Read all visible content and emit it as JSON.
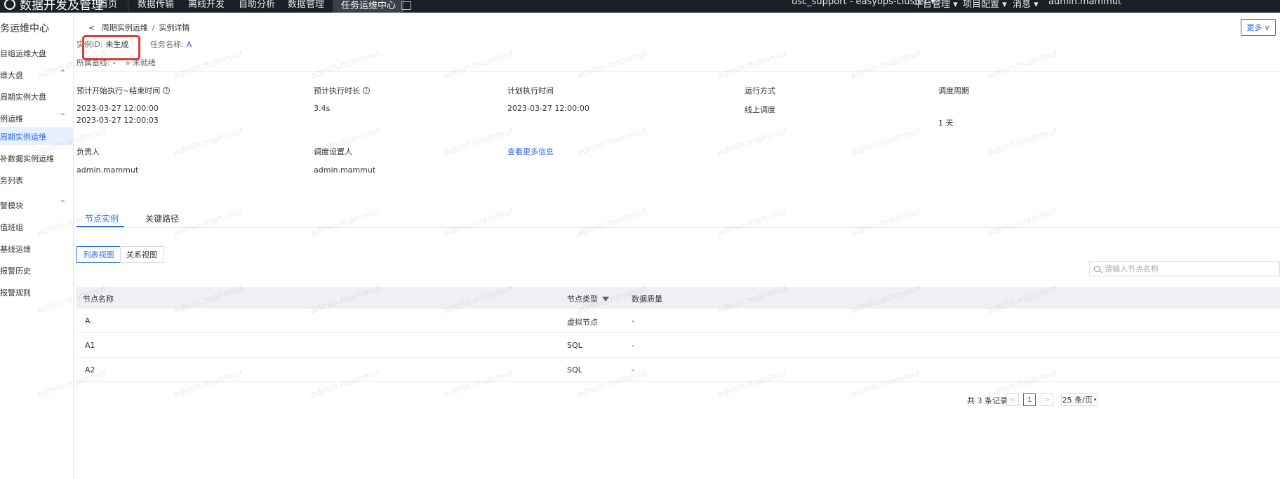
{
  "topbar": {
    "logo": "数据开发及管理",
    "tabs": [
      "首页",
      "数据传输",
      "离线开发",
      "自助分析",
      "数据管理",
      "任务运维中心"
    ],
    "active_tab": "任务运维中心",
    "cluster": "usc_support - easyops-cluster",
    "platform": "平台管理",
    "project": "项目配置",
    "messages": "消息",
    "user": "admin.mammut"
  },
  "sidebar": {
    "title": "务运维中心",
    "items": [
      {
        "label": "目组运维大盘",
        "chevron": ""
      },
      {
        "label": "维大盘",
        "chevron": "^"
      },
      {
        "label": "周期实例大盘",
        "chevron": ""
      },
      {
        "label": "例运维",
        "chevron": "^"
      },
      {
        "label": "周期实例运维",
        "chevron": ""
      },
      {
        "label": "补数据实例运维",
        "chevron": ""
      },
      {
        "label": "务列表",
        "chevron": ""
      },
      {
        "label": "警模块",
        "chevron": "^"
      },
      {
        "label": "值班组",
        "chevron": ""
      },
      {
        "label": "基线运维",
        "chevron": ""
      },
      {
        "label": "报警历史",
        "chevron": ""
      },
      {
        "label": "报警规则",
        "chevron": ""
      }
    ]
  },
  "breadcrumb": {
    "parent": "周期实例运维",
    "separator": "/",
    "current": "实例详情"
  },
  "more_button": "更多",
  "instance": {
    "id_label": "实例ID:",
    "id_value": "未生成",
    "task_label": "任务名称:",
    "task_value": "A",
    "baseline_label": "所属基线:",
    "baseline_value": "-",
    "status": "未就绪"
  },
  "fields": {
    "expected_window_label": "预计开始执行~结束时间",
    "expected_window_start": "2023-03-27 12:00:00",
    "expected_window_end": "2023-03-27 12:00:03",
    "expected_duration_label": "预计执行时长",
    "expected_duration_value": "3.4s",
    "plan_time_label": "计划执行时间",
    "plan_time_value": "2023-03-27 12:00:00",
    "run_mode_label": "运行方式",
    "run_mode_value": "线上调度",
    "cycle_label": "调度周期",
    "cycle_value": "1 天",
    "owner_label": "负责人",
    "owner_value": "admin.mammut",
    "scheduler_label": "调度设置人",
    "scheduler_value": "admin.mammut",
    "more_info": "查看更多信息"
  },
  "tabs": [
    "节点实例",
    "关键路径"
  ],
  "views": [
    "列表视图",
    "关系视图"
  ],
  "search": {
    "placeholder": "请输入节点名称"
  },
  "table": {
    "headers": {
      "name": "节点名称",
      "type": "节点类型",
      "quality": "数据质量"
    },
    "rows": [
      {
        "name": "A",
        "type": "虚拟节点",
        "quality": "-"
      },
      {
        "name": "A1",
        "type": "SQL",
        "quality": "-"
      },
      {
        "name": "A2",
        "type": "SQL",
        "quality": "-"
      }
    ]
  },
  "pagination": {
    "total": "共 3 条记录",
    "prev": "<",
    "page": "1",
    "next": ">",
    "page_size": "25 条/页"
  },
  "watermark": "admin.mammut"
}
